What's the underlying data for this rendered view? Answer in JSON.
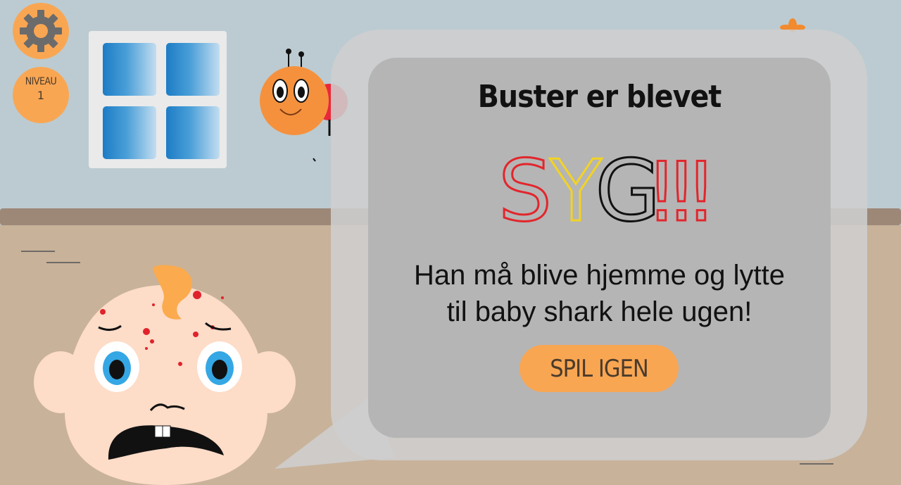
{
  "hud": {
    "settings_icon": "gear-icon",
    "level_label": "NIVEAU",
    "level_value": "1"
  },
  "dialog": {
    "title": "Buster er blevet",
    "headline": {
      "letters": [
        {
          "char": "S",
          "color": "#e2262c"
        },
        {
          "char": "Y",
          "color": "#f2d324"
        },
        {
          "char": "G",
          "color": "#111111"
        },
        {
          "char": "!",
          "color": "#e2262c"
        },
        {
          "char": "!",
          "color": "#e2262c"
        },
        {
          "char": "!",
          "color": "#e2262c"
        }
      ]
    },
    "message_line1": "Han må blive hjemme og lytte",
    "message_line2": "til baby shark hele ugen!",
    "play_again_label": "SPIL IGEN"
  },
  "colors": {
    "accent_orange": "#f9a653",
    "wall": "#bccbd1",
    "floor": "#c8b29a"
  }
}
